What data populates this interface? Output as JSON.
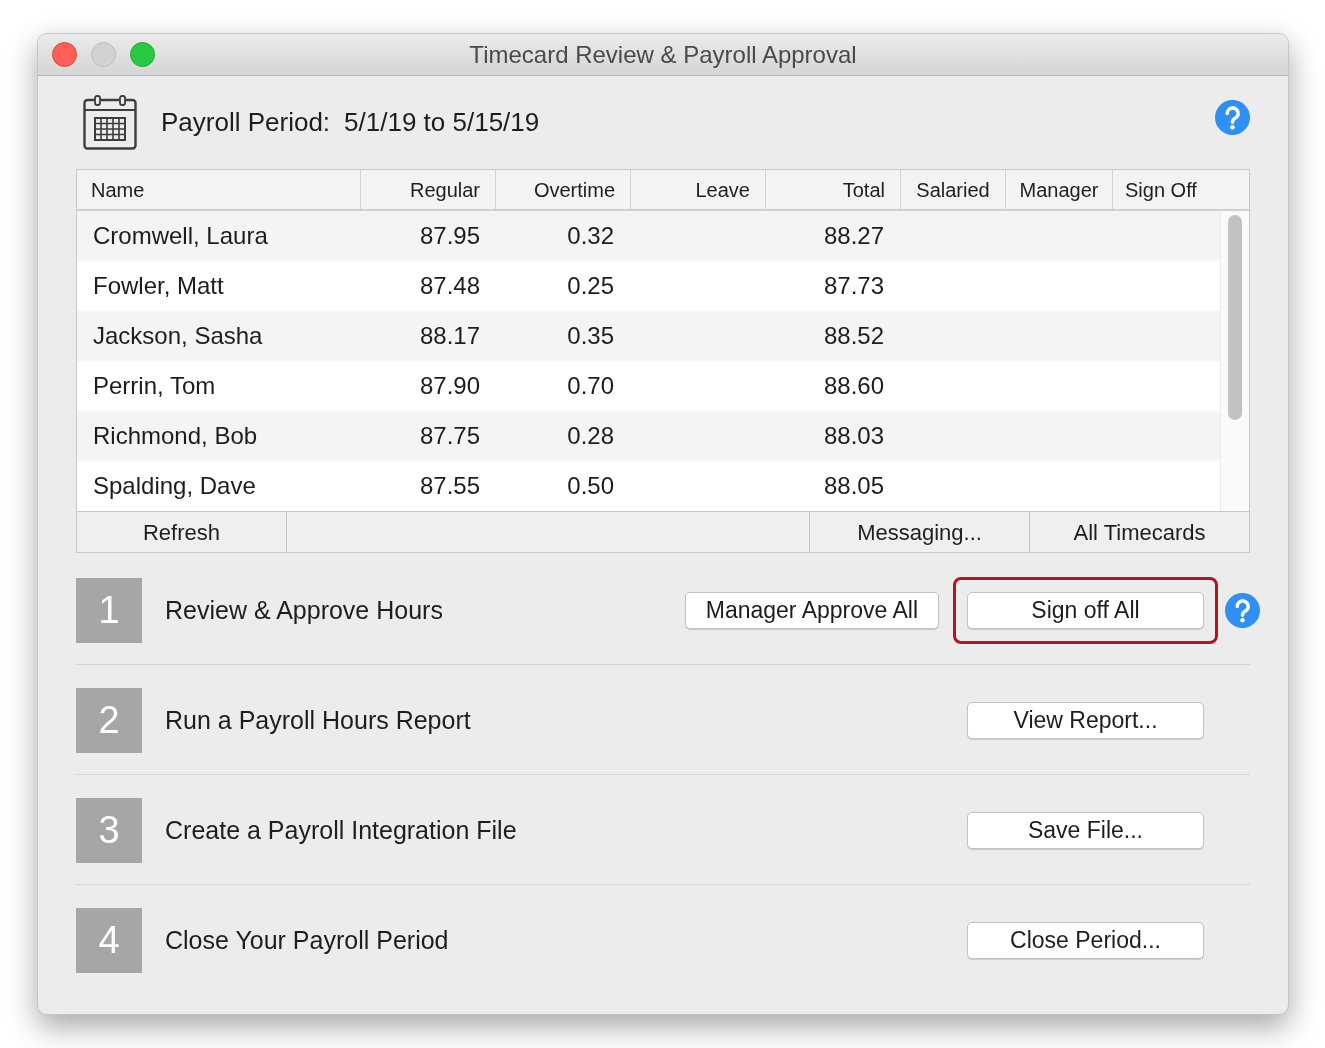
{
  "window": {
    "title": "Timecard Review & Payroll Approval",
    "buttons": [
      {
        "kind": "close",
        "disabled": false
      },
      {
        "kind": "minimize",
        "disabled": true
      },
      {
        "kind": "zoom",
        "disabled": false
      }
    ]
  },
  "header": {
    "label": "Payroll Period:",
    "period": "5/1/19 to 5/15/19",
    "help": true
  },
  "table": {
    "columns": [
      "Name",
      "Regular",
      "Overtime",
      "Leave",
      "Total",
      "Salaried",
      "Manager",
      "Sign Off"
    ],
    "rows": [
      {
        "name": "Cromwell, Laura",
        "regular": "87.95",
        "overtime": "0.32",
        "total": "88.27"
      },
      {
        "name": "Fowler, Matt",
        "regular": "87.48",
        "overtime": "0.25",
        "total": "87.73"
      },
      {
        "name": "Jackson, Sasha",
        "regular": "88.17",
        "overtime": "0.35",
        "total": "88.52"
      },
      {
        "name": "Perrin, Tom",
        "regular": "87.90",
        "overtime": "0.70",
        "total": "88.60"
      },
      {
        "name": "Richmond, Bob",
        "regular": "87.75",
        "overtime": "0.28",
        "total": "88.03"
      },
      {
        "name": "Spalding, Dave",
        "regular": "87.55",
        "overtime": "0.50",
        "total": "88.05"
      }
    ],
    "footer_buttons": [
      "Refresh",
      "Messaging...",
      "All Timecards"
    ]
  },
  "steps": [
    {
      "number": "1",
      "title": "Review & Approve Hours",
      "buttons": [
        {
          "label": "Manager Approve All",
          "highlighted": false
        },
        {
          "label": "Sign off All",
          "highlighted": true
        }
      ],
      "help": true
    },
    {
      "number": "2",
      "title": "Run a Payroll Hours Report",
      "buttons": [
        {
          "label": "View Report...",
          "highlighted": false
        }
      ],
      "help": false
    },
    {
      "number": "3",
      "title": "Create a Payroll Integration File",
      "buttons": [
        {
          "label": "Save File...",
          "highlighted": false
        }
      ],
      "help": false
    },
    {
      "number": "4",
      "title": "Close Your Payroll Period",
      "buttons": [
        {
          "label": "Close Period...",
          "highlighted": false
        }
      ],
      "help": false
    }
  ]
}
